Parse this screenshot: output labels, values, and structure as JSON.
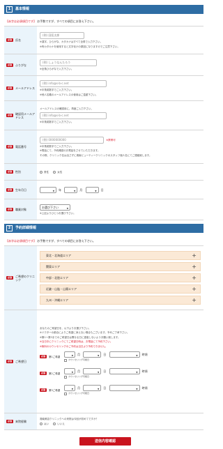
{
  "section1": {
    "num": "1",
    "title": "基本情報",
    "required_note": "【赤字は必須項目です】",
    "note_rest": "お手数ですが、すべての項目にお答え下さい。"
  },
  "badge": "必須",
  "name": {
    "label": "氏名",
    "placeholder": "(例) 田医太郎",
    "hint1": "※漢字、ひらがな、カタカナはすべて全角で入力下さい。",
    "hint2": "※有カタカナを使用すると文字化けの原因になりますのでご注意下さい。"
  },
  "furigana": {
    "label": "ふりがな",
    "placeholder": "(例) しょうなんたろう",
    "hint1": "※全角ひらがなで入力下さい。"
  },
  "email": {
    "label": "メールアドレス",
    "placeholder": "(例) info@s-b-c.net",
    "hint1": "※半角英数字でご入力下さい。",
    "hint2": "※他人名義のメールアドレスの使用はご遠慮下さい。"
  },
  "email_confirm": {
    "label": "確認用メールアドレス",
    "top_note": "メールアドレスの確認用に、再度ご入力下さい。",
    "placeholder": "(例) info@s-b-c.net",
    "hint1": "※半角英数字でご入力下さい。"
  },
  "phone": {
    "label": "電話番号",
    "placeholder": "(例) 0000000000",
    "after": "※携帯可",
    "hint1": "※半角英数字でご入力下さい。",
    "hint2": "※電話にて、予約確認のお電話をさせていただきます。",
    "hint3": "その際、クリニック名は出さずに湘南ビューティークリニックのスタッフ個人名にてご連絡致します。"
  },
  "gender": {
    "label": "性別",
    "options": [
      "男性",
      "女性"
    ]
  },
  "birthday": {
    "label": "生年月日",
    "year_unit": "年",
    "month_unit": "月",
    "day_unit": "日"
  },
  "occupation": {
    "label": "職業対象",
    "selected": "お選び下さい",
    "hint1": "※上記よりひとつお選び下さい。"
  },
  "section2": {
    "num": "2",
    "title": "予約詳細情報",
    "required_note": "【赤字は必須項目です】",
    "note_rest": "お手数ですが、すべての項目にお答え下さい。"
  },
  "clinic": {
    "label": "ご希望のクリニック",
    "areas": [
      "東北・北海道エリア",
      "関東エリア",
      "中部・北陸エリア",
      "近畿・山陰・山陽エリア",
      "九州・沖縄エリア"
    ]
  },
  "dates": {
    "label": "ご希望日",
    "intro1": "あなたのご希望日を、以下よりお選び下さい。",
    "intro2": "※ドクターの都合によりご希望に添えない場合もございます。予めご了承下さい。",
    "intro3": "※第1～第3までのご希望日は異なる日に重複しないようお願い致します。",
    "red1": "※当日中にクリニックにてご希望日時は、お電話にて予約下さい。",
    "red2": "※無料のカウンセリングのご予約は当日より予約できません。",
    "rows": [
      {
        "label": "第1ご希望",
        "month_unit": "月",
        "day_unit": "日",
        "time_unit": "時頃",
        "check": "カウンセリング可能日"
      },
      {
        "label": "第2ご希望",
        "month_unit": "月",
        "day_unit": "日",
        "time_unit": "時頃",
        "check": "カウンセリング可能日"
      },
      {
        "label": "第3ご希望",
        "month_unit": "月",
        "day_unit": "日",
        "time_unit": "時頃",
        "check": "カウンセリング可能日"
      }
    ]
  },
  "visit": {
    "label": "来院経験",
    "question": "湘南美容クリニックへの来院は今回が初めてですか？",
    "options": [
      "はい",
      "いいえ"
    ]
  },
  "submit": {
    "label": "送信内容確認"
  }
}
